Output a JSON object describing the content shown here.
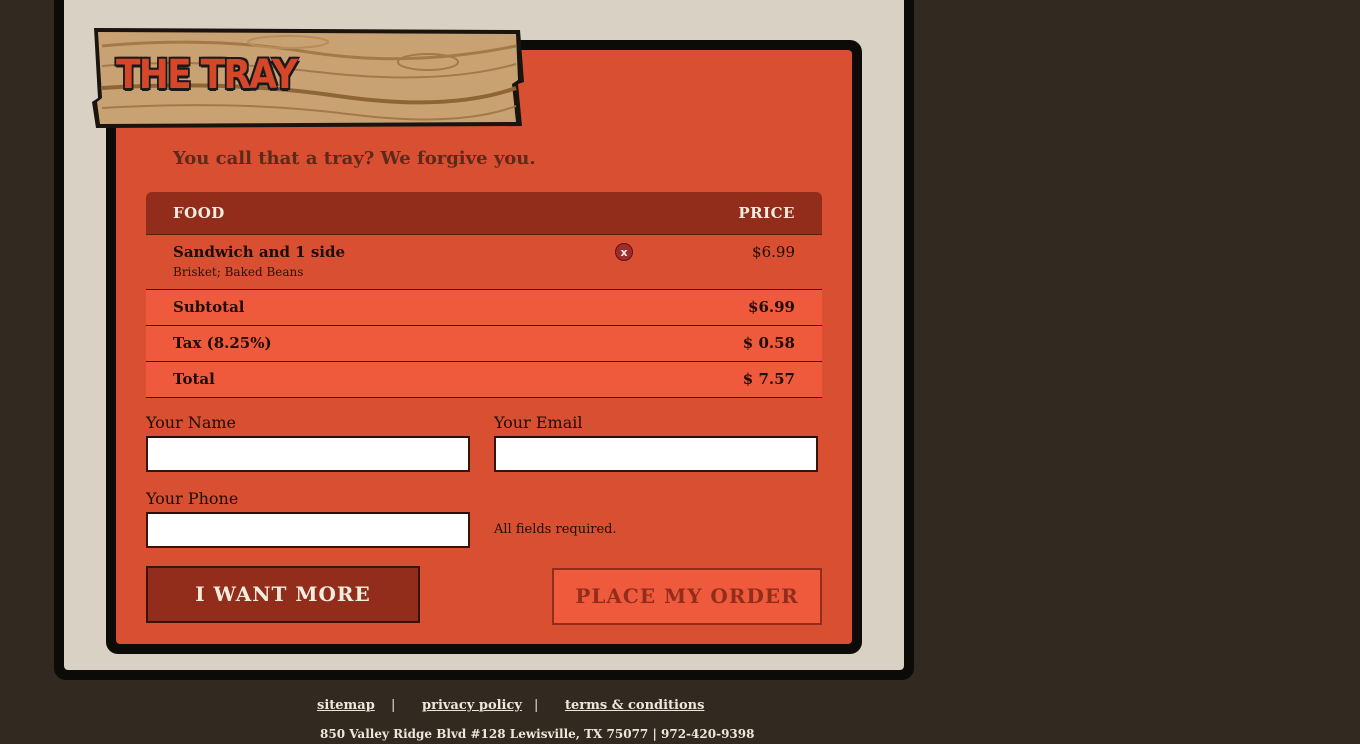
{
  "sign": {
    "title": "THE TRAY"
  },
  "tagline": "You call that a tray? We forgive you.",
  "table": {
    "headers": {
      "food": "FOOD",
      "price": "PRICE"
    },
    "items": [
      {
        "name": "Sandwich and 1 side",
        "description": "Brisket; Baked Beans",
        "price": "$6.99",
        "remove": "x"
      }
    ],
    "summary": [
      {
        "label": "Subtotal",
        "value": "$6.99"
      },
      {
        "label": "Tax (8.25%)",
        "value": "$ 0.58"
      },
      {
        "label": "Total",
        "value": "$ 7.57"
      }
    ]
  },
  "form": {
    "name_label": "Your Name",
    "name_value": "",
    "email_label": "Your Email",
    "email_value": "",
    "phone_label": "Your Phone",
    "phone_value": "",
    "required_note": "All fields required."
  },
  "buttons": {
    "more": "I WANT MORE",
    "order": "PLACE MY ORDER"
  },
  "footer": {
    "links": [
      "sitemap",
      "privacy policy",
      "terms & conditions"
    ],
    "separator": "|",
    "address": "850 Valley Ridge Blvd #128 Lewisville, TX 75077 | 972-420-9398"
  },
  "colors": {
    "background": "#322a20",
    "paper": "#d9d1c4",
    "tray": "#d84f31",
    "header": "#922d1b",
    "summary_row": "#ef5a3c"
  }
}
